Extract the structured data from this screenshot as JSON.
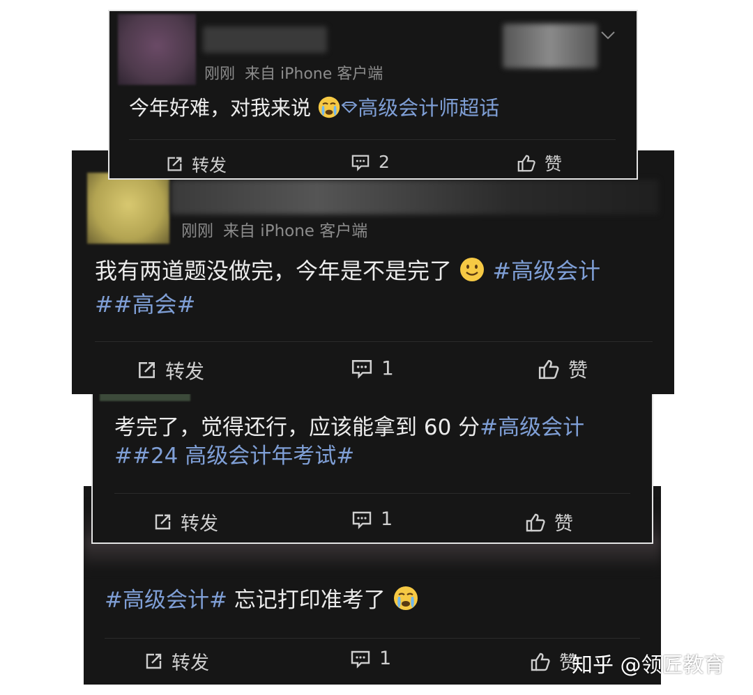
{
  "colors": {
    "card_bg": "#161616",
    "topic": "#7f9fd6",
    "meta": "#8c8c8c",
    "text": "#ececec"
  },
  "posts": [
    {
      "time": "刚刚",
      "source": "来自 iPhone 客户端",
      "text": "今年好难，对我来说",
      "emoji": "crying-face",
      "topic_icon": "diamond-icon",
      "topic": "高级会计师超话",
      "actions": {
        "repost": "转发",
        "comments": "2",
        "like": "赞"
      }
    },
    {
      "time": "刚刚",
      "source": "来自 iPhone 客户端",
      "text": "我有两道题没做完，今年是不是完了",
      "emoji": "smiling-face",
      "topic1": "#高级会计",
      "topic2": "##高会#",
      "actions": {
        "repost": "转发",
        "comments": "1",
        "like": "赞"
      }
    },
    {
      "text": "考完了，觉得还行，应该能拿到 60 分",
      "topic1": "#高级会计",
      "topic2": "##24 高级会计年考试#",
      "actions": {
        "repost": "转发",
        "comments": "1",
        "like": "赞"
      }
    },
    {
      "topic": "#高级会计#",
      "text": " 忘记打印准考了",
      "emoji": "crying-face",
      "actions": {
        "repost": "转发",
        "comments": "1",
        "like": "赞"
      }
    }
  ],
  "watermark": "知乎 @领匠教育"
}
